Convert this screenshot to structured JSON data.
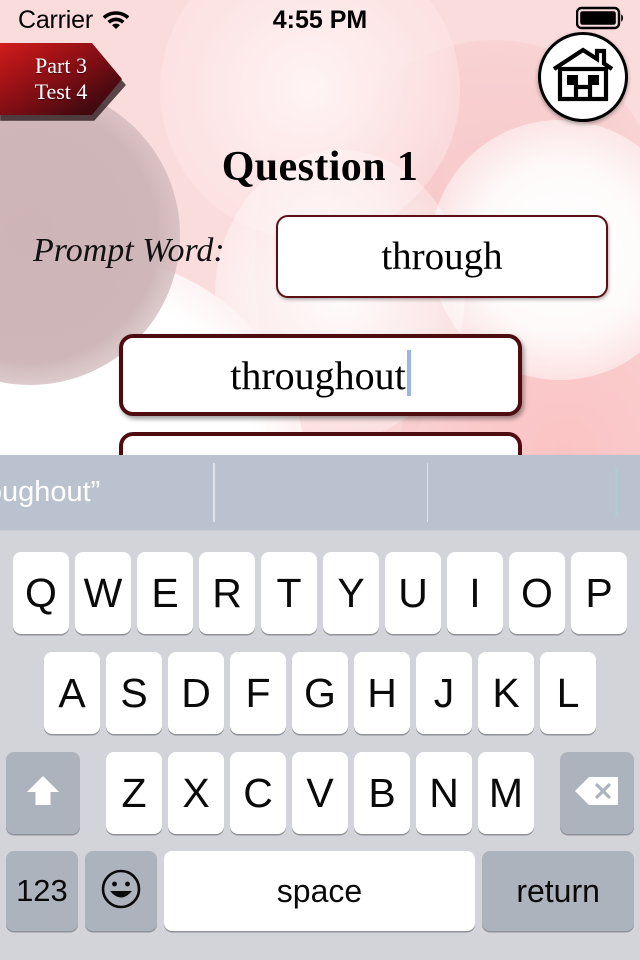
{
  "status_bar": {
    "carrier": "Carrier",
    "wifi_icon": "wifi-icon",
    "time": "4:55 PM",
    "battery_icon": "battery-full-icon"
  },
  "ribbon": {
    "line1": "Part 3",
    "line2": "Test 4"
  },
  "home_button": {
    "icon": "house-icon"
  },
  "main": {
    "question_title": "Question 1",
    "prompt_label": "Prompt Word:",
    "prompt_value": "through",
    "answer_value": "throughout",
    "answer_placeholder": ""
  },
  "predictive_bar": {
    "suggestions": [
      "throughout”",
      "",
      ""
    ]
  },
  "keyboard": {
    "row1": [
      "Q",
      "W",
      "E",
      "R",
      "T",
      "Y",
      "U",
      "I",
      "O",
      "P"
    ],
    "row2": [
      "A",
      "S",
      "D",
      "F",
      "G",
      "H",
      "J",
      "K",
      "L"
    ],
    "row3": [
      "Z",
      "X",
      "C",
      "V",
      "B",
      "N",
      "M"
    ],
    "shift_icon": "shift-icon",
    "delete_icon": "backspace-icon",
    "numeric_label": "123",
    "emoji_icon": "emoji-smiley-icon",
    "space_label": "space",
    "return_label": "return"
  },
  "colors": {
    "background_pink": "#fbdcdd",
    "field_border": "#4e0c10",
    "ribbon_red": "#b01417",
    "keyboard_bg": "#d2d4da",
    "key_white": "#ffffff",
    "key_gray": "#adb3bd",
    "predictive_bg": "#b9c2ce",
    "caret_blue": "#9bb6e0"
  }
}
